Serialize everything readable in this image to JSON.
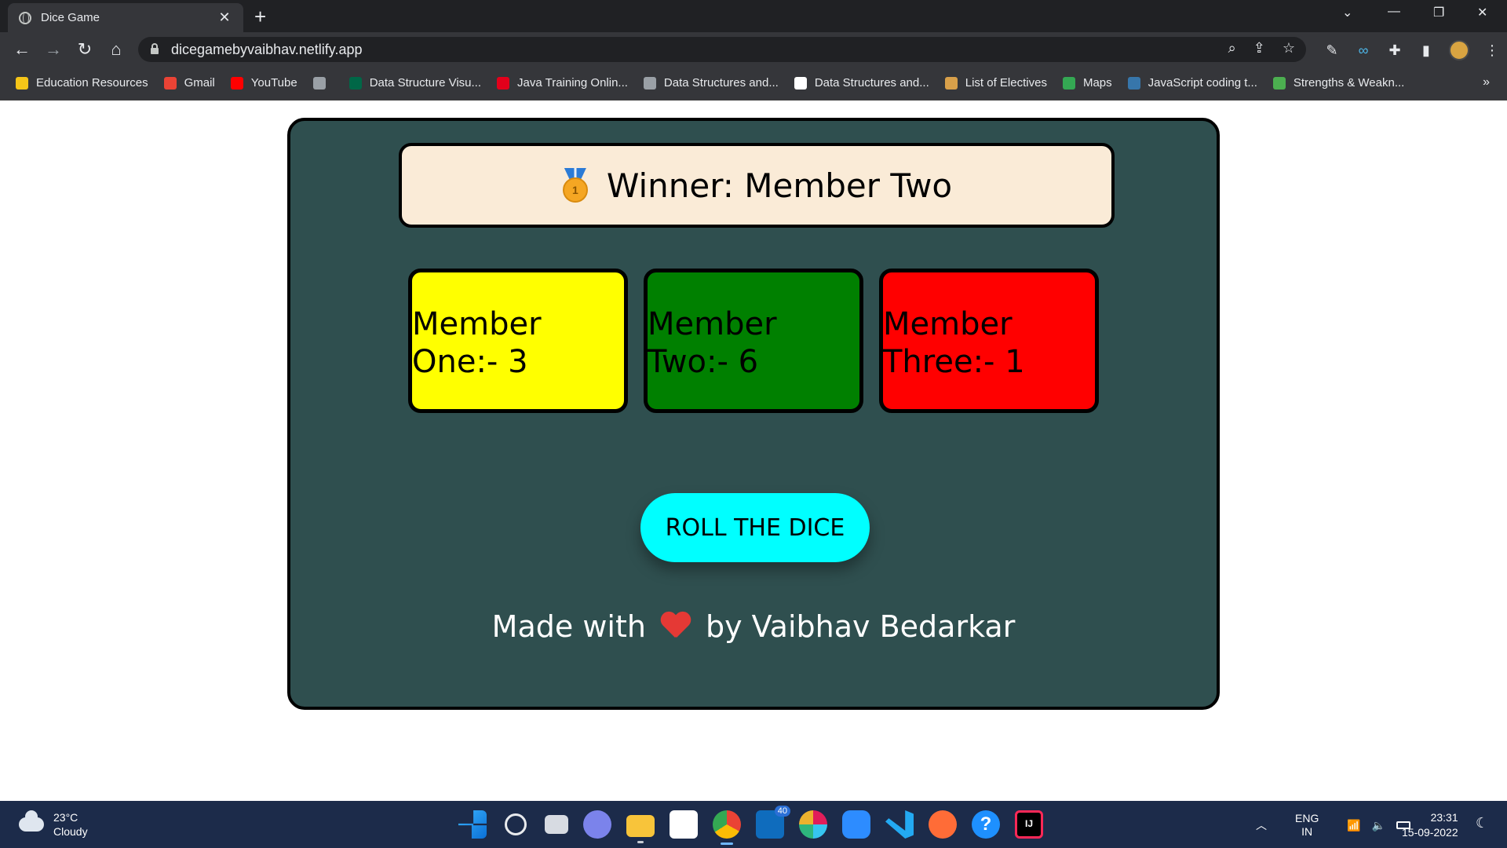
{
  "browser": {
    "tab_title": "Dice Game",
    "url": "dicegamebyvaibhav.netlify.app",
    "bookmarks": [
      {
        "label": "Education Resources",
        "icon": "folder-icon",
        "color": "#f5c518"
      },
      {
        "label": "Gmail",
        "icon": "gmail-icon",
        "color": "#ea4335"
      },
      {
        "label": "YouTube",
        "icon": "youtube-icon",
        "color": "#ff0000"
      },
      {
        "label": "",
        "icon": "globe-icon",
        "color": "#9aa0a6"
      },
      {
        "label": "Data Structure Visu...",
        "icon": "usf-icon",
        "color": "#006747"
      },
      {
        "label": "Java Training Onlin...",
        "icon": "oracle-icon",
        "color": "#e3001b"
      },
      {
        "label": "Data Structures and...",
        "icon": "dash-icon",
        "color": "#9aa0a6"
      },
      {
        "label": "Data Structures and...",
        "icon": "cc-icon",
        "color": "#ffffff"
      },
      {
        "label": "List of Electives",
        "icon": "scroll-icon",
        "color": "#d8a04a"
      },
      {
        "label": "Maps",
        "icon": "maps-icon",
        "color": "#34a853"
      },
      {
        "label": "JavaScript coding t...",
        "icon": "python-icon",
        "color": "#3776ab"
      },
      {
        "label": "Strengths & Weakn...",
        "icon": "dots-icon",
        "color": "#4caf50"
      }
    ]
  },
  "game": {
    "winner_text": "Winner: Member Two",
    "members": [
      {
        "label": "Member One:- 3",
        "color": "#ffff00"
      },
      {
        "label": "Member Two:- 6",
        "color": "#008000"
      },
      {
        "label": "Member Three:- 1",
        "color": "#ff0000"
      }
    ],
    "roll_button": "ROLL THE DICE",
    "credit_prefix": "Made with",
    "credit_suffix": "by Vaibhav Bedarkar"
  },
  "taskbar": {
    "temperature": "23°C",
    "condition": "Cloudy",
    "language_line1": "ENG",
    "language_line2": "IN",
    "time": "23:31",
    "date": "15-09-2022",
    "notification_badge": "40"
  },
  "colors": {
    "card_bg": "#2f4f4f",
    "winner_bg": "#faebd7",
    "button_bg": "#00ffff"
  }
}
